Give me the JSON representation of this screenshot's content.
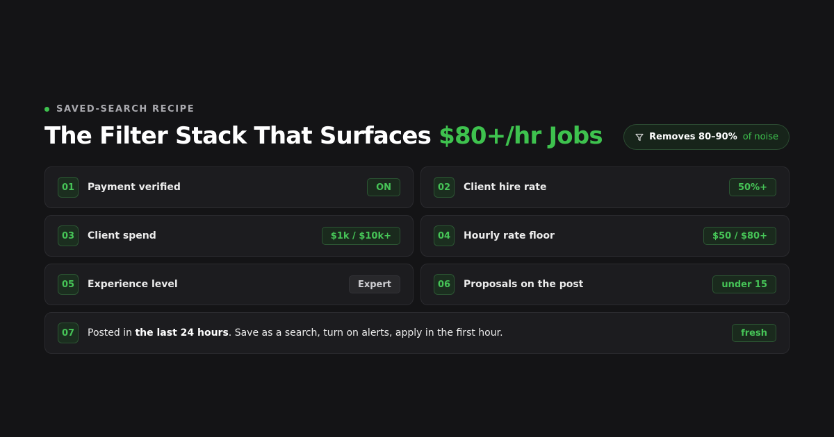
{
  "eyebrow": "SAVED-SEARCH RECIPE",
  "title": {
    "main": "The Filter Stack That Surfaces ",
    "accent": "$80+/hr Jobs"
  },
  "noise_pill": {
    "strong": "Removes 80–90%",
    "soft": "of noise",
    "icon": "funnel-icon"
  },
  "filters": [
    {
      "num": "01",
      "label": "Payment verified",
      "value": "ON"
    },
    {
      "num": "02",
      "label": "Client hire rate",
      "value": "50%+"
    },
    {
      "num": "03",
      "label": "Client spend",
      "value": "$1k / $10k+"
    },
    {
      "num": "04",
      "label": "Hourly rate floor",
      "value": "$50 / $80+"
    },
    {
      "num": "05",
      "label": "Experience level",
      "value": "Expert"
    },
    {
      "num": "06",
      "label": "Proposals on the post",
      "value": "under 15"
    }
  ],
  "final": {
    "num": "07",
    "prefix": "Posted in ",
    "emphasis": "the last 24 hours",
    "suffix": ". Save as a search, turn on alerts, apply in the first hour.",
    "value": "fresh"
  },
  "colors": {
    "accent": "#3ec24e",
    "background": "#141416",
    "card": "#1c1c1f"
  }
}
